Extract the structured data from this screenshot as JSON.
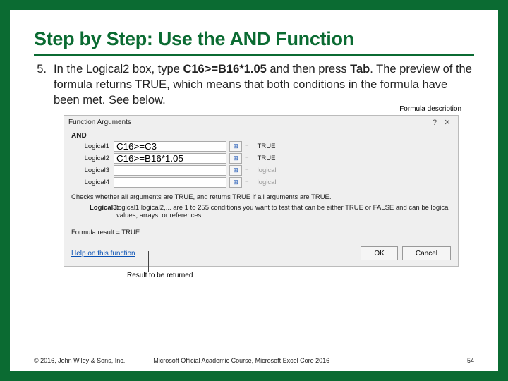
{
  "title": "Step by Step: Use the AND Function",
  "step": {
    "number": "5.",
    "pre": "In the Logical2 box, type ",
    "code": "C16>=B16*1.05",
    "mid": " and then press ",
    "key": "Tab",
    "post": ". The preview of the formula returns TRUE, which means that both conditions in the formula have been met. See below."
  },
  "callouts": {
    "formula_desc": "Formula description",
    "result_returned": "Result to be returned"
  },
  "dialog": {
    "title": "Function Arguments",
    "help_btn": "?",
    "close_btn": "✕",
    "func_name": "AND",
    "rows": [
      {
        "label": "Logical1",
        "value": "C16>=C3",
        "display": "TRUE"
      },
      {
        "label": "Logical2",
        "value": "C16>=B16*1.05",
        "display": "TRUE"
      },
      {
        "label": "Logical3",
        "value": "",
        "display": "logical"
      },
      {
        "label": "Logical4",
        "value": "",
        "display": "logical"
      }
    ],
    "desc1": "Checks whether all arguments are TRUE, and returns TRUE if all arguments are TRUE.",
    "desc2_key": "Logical3:",
    "desc2_text": "logical1,logical2,... are 1 to 255 conditions you want to test that can be either TRUE or FALSE and can be logical values, arrays, or references.",
    "result_label": "Formula result =",
    "result_value": "TRUE",
    "help": "Help on this function",
    "ok": "OK",
    "cancel": "Cancel"
  },
  "footer": {
    "copyright": "© 2016, John Wiley & Sons, Inc.",
    "course": "Microsoft Official Academic Course, Microsoft Excel Core 2016",
    "page": "54"
  }
}
